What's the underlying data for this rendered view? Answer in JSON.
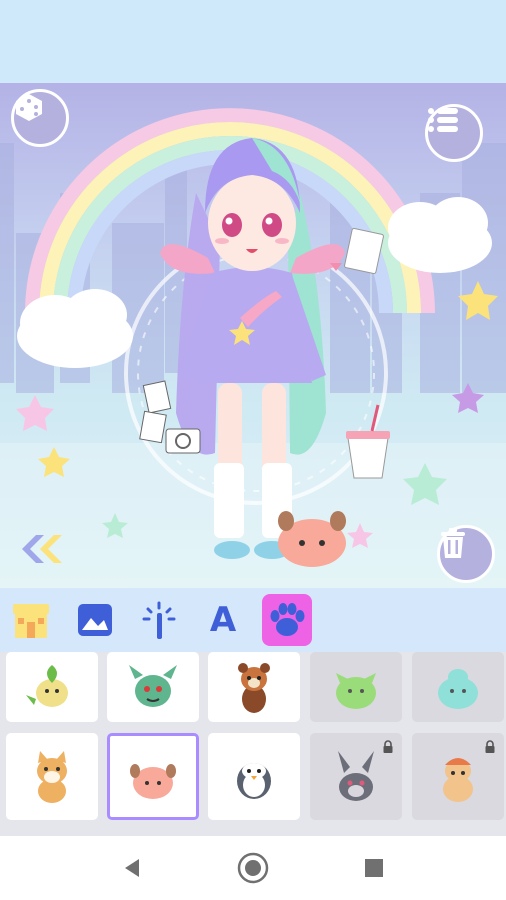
{
  "toolbar": {
    "tabs": [
      {
        "name": "shop-tab",
        "icon": "shop-icon",
        "active": false
      },
      {
        "name": "background-tab",
        "icon": "picture-icon",
        "active": false
      },
      {
        "name": "effects-tab",
        "icon": "magic-wand-icon",
        "active": false
      },
      {
        "name": "text-tab",
        "icon": "letter-a-icon",
        "label": "A",
        "active": false
      },
      {
        "name": "pets-tab",
        "icon": "paw-icon",
        "active": true
      }
    ],
    "active_color": "#ee62e6",
    "icon_color": "#3f5fd8"
  },
  "pets": {
    "items": [
      {
        "name": "leaf-dino",
        "locked": false,
        "selected": false
      },
      {
        "name": "green-dragon",
        "locked": false,
        "selected": false
      },
      {
        "name": "red-panda",
        "locked": false,
        "selected": false
      },
      {
        "name": "green-slime",
        "locked": true,
        "selected": false
      },
      {
        "name": "teal-slime",
        "locked": true,
        "selected": false
      },
      {
        "name": "shiba-dog",
        "locked": false,
        "selected": false
      },
      {
        "name": "pink-blob",
        "locked": false,
        "selected": true
      },
      {
        "name": "penguin",
        "locked": false,
        "selected": false
      },
      {
        "name": "gray-bunny",
        "locked": true,
        "selected": false
      },
      {
        "name": "knit-bear",
        "locked": true,
        "selected": false
      }
    ],
    "selected_color": "#a98cff"
  },
  "scene": {
    "buttons": [
      "dice-icon",
      "menu-list-icon",
      "double-chevron-left-icon",
      "trash-icon"
    ],
    "accent": "#b4b1df"
  },
  "navigation": [
    "back-triangle-icon",
    "home-circle-icon",
    "recents-square-icon"
  ]
}
